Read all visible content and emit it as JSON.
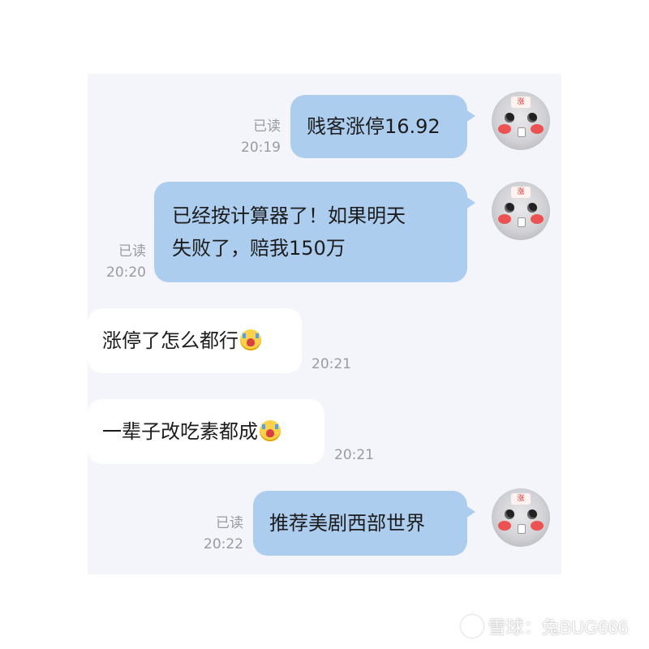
{
  "messages": [
    {
      "direction": "out",
      "text": "贱客涨停16.92",
      "read": "已读",
      "time": "20:19"
    },
    {
      "direction": "out",
      "line1": "已经按计算器了！如果明天",
      "line2": "失败了，赔我150万",
      "read": "已读",
      "time": "20:20"
    },
    {
      "direction": "in",
      "text": "涨停了怎么都行",
      "emoji": "crying-face",
      "time": "20:21"
    },
    {
      "direction": "in",
      "text": "一辈子改吃素都成",
      "emoji": "crying-face",
      "time": "20:21"
    },
    {
      "direction": "out",
      "text": "推荐美剧西部世界",
      "read": "已读",
      "time": "20:22"
    }
  ],
  "avatar": {
    "tag": "涨"
  },
  "watermark": {
    "text": "雪球：兔BUG666"
  },
  "colors": {
    "outgoing_bubble": "#adcdef",
    "incoming_bubble": "#ffffff",
    "chat_background": "#f4f5fa",
    "meta_text": "#9a9a9f"
  }
}
